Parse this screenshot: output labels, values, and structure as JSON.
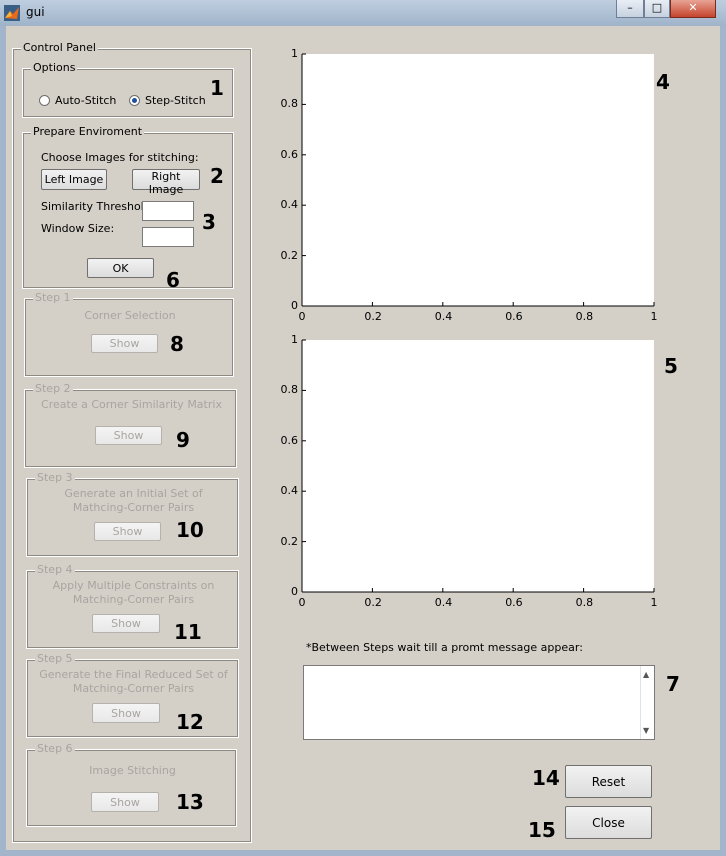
{
  "window": {
    "title": "gui",
    "minimize": "–",
    "maximize": "□",
    "close": "✕"
  },
  "control_panel": {
    "title": "Control Panel",
    "options": {
      "title": "Options",
      "auto_stitch": "Auto-Stitch",
      "step_stitch": "Step-Stitch",
      "selected": "Step-Stitch",
      "marker": "1"
    },
    "prepare": {
      "title": "Prepare Enviroment",
      "choose_label": "Choose Images for stitching:",
      "left_image": "Left Image",
      "right_image": "Right Image",
      "marker_images": "2",
      "similarity_label": "Similarity Threshold:",
      "window_label": "Window Size:",
      "similarity_value": "",
      "window_value": "",
      "marker_inputs": "3",
      "ok": "OK",
      "marker_ok": "6"
    },
    "steps": [
      {
        "title": "Step 1",
        "line1": "Corner Selection",
        "line2": "",
        "button": "Show",
        "marker": "8"
      },
      {
        "title": "Step 2",
        "line1": "Create a Corner Similarity Matrix",
        "line2": "",
        "button": "Show",
        "marker": "9"
      },
      {
        "title": "Step 3",
        "line1": "Generate an Initial Set of",
        "line2": "Mathcing-Corner Pairs",
        "button": "Show",
        "marker": "10"
      },
      {
        "title": "Step 4",
        "line1": "Apply Multiple Constraints on",
        "line2": "Matching-Corner Pairs",
        "button": "Show",
        "marker": "11"
      },
      {
        "title": "Step 5",
        "line1": "Generate the Final Reduced Set of",
        "line2": "Matching-Corner Pairs",
        "button": "Show",
        "marker": "12"
      },
      {
        "title": "Step 6",
        "line1": "Image Stitching",
        "line2": "",
        "button": "Show",
        "marker": "13"
      }
    ]
  },
  "axes": [
    {
      "marker": "4",
      "xticks": [
        "0",
        "0.2",
        "0.4",
        "0.6",
        "0.8",
        "1"
      ],
      "yticks": [
        "0",
        "0.2",
        "0.4",
        "0.6",
        "0.8",
        "1"
      ],
      "xlim": [
        0,
        1
      ],
      "ylim": [
        0,
        1
      ]
    },
    {
      "marker": "5",
      "xticks": [
        "0",
        "0.2",
        "0.4",
        "0.6",
        "0.8",
        "1"
      ],
      "yticks": [
        "0",
        "0.2",
        "0.4",
        "0.6",
        "0.8",
        "1"
      ],
      "xlim": [
        0,
        1
      ],
      "ylim": [
        0,
        1
      ]
    }
  ],
  "message": {
    "label": "*Between Steps wait till a promt message appear:",
    "value": "",
    "marker": "7"
  },
  "actions": {
    "reset": "Reset",
    "reset_marker": "14",
    "close": "Close",
    "close_marker": "15"
  },
  "colors": {
    "background": "#d4d0c8",
    "disabled_text": "#a8a5a0",
    "radio_dot": "#1f4f9e"
  }
}
